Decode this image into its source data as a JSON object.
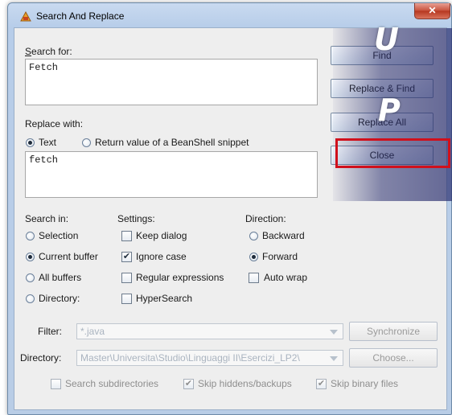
{
  "window": {
    "title": "Search And Replace",
    "close_glyph": "✕"
  },
  "search": {
    "label": "Search for:",
    "value": "Fetch"
  },
  "replace": {
    "label": "Replace with:",
    "value": "fetch",
    "mode_options": [
      {
        "label": "Text",
        "selected": true
      },
      {
        "label": "Return value of a BeanShell snippet",
        "selected": false
      }
    ]
  },
  "buttons": {
    "find": "Find",
    "replace_find": "Replace & Find",
    "replace_all": "Replace All",
    "close": "Close",
    "synchronize": "Synchronize",
    "choose": "Choose..."
  },
  "search_in": {
    "label": "Search in:",
    "options": [
      {
        "label": "Selection",
        "selected": false
      },
      {
        "label": "Current buffer",
        "selected": true
      },
      {
        "label": "All buffers",
        "selected": false
      },
      {
        "label": "Directory:",
        "selected": false
      }
    ]
  },
  "settings": {
    "label": "Settings:",
    "options": [
      {
        "label": "Keep dialog",
        "checked": false
      },
      {
        "label": "Ignore case",
        "checked": true
      },
      {
        "label": "Regular expressions",
        "checked": false
      },
      {
        "label": "HyperSearch",
        "checked": false
      }
    ]
  },
  "direction": {
    "label": "Direction:",
    "options": [
      {
        "label": "Backward",
        "selected": false
      },
      {
        "label": "Forward",
        "selected": true
      }
    ],
    "auto_wrap": {
      "label": "Auto wrap",
      "checked": false
    }
  },
  "filter": {
    "label": "Filter:",
    "value": "*.java"
  },
  "directory": {
    "label": "Directory:",
    "value": "Master\\Universita\\Studio\\Linguaggi II\\Esercizi_LP2\\"
  },
  "bottom_checks": [
    {
      "label": "Search subdirectories",
      "checked": false
    },
    {
      "label": "Skip hiddens/backups",
      "checked": true
    },
    {
      "label": "Skip binary files",
      "checked": true
    }
  ],
  "overlay_letters": [
    "U",
    "P"
  ],
  "colors": {
    "highlight": "#d0101c",
    "overlay": "#28306e"
  }
}
